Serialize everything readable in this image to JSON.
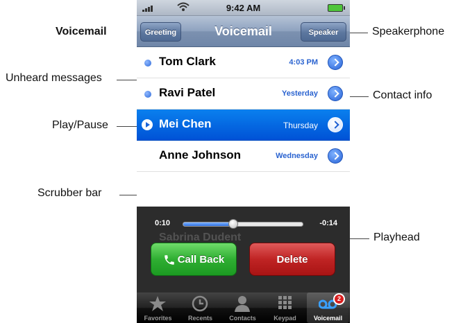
{
  "status_bar": {
    "time": "9:42 AM"
  },
  "nav_bar": {
    "title": "Voicemail",
    "left_button": "Greeting",
    "right_button": "Speaker"
  },
  "messages": [
    {
      "name": "Tom Clark",
      "time": "4:03 PM",
      "unheard": true,
      "selected": false
    },
    {
      "name": "Ravi Patel",
      "time": "Yesterday",
      "unheard": true,
      "selected": false
    },
    {
      "name": "Mei Chen",
      "time": "Thursday",
      "unheard": false,
      "selected": true
    },
    {
      "name": "Anne Johnson",
      "time": "Wednesday",
      "unheard": false,
      "selected": false
    }
  ],
  "playback": {
    "elapsed": "0:10",
    "remaining": "-0:14",
    "progress": 0.42,
    "call_back_label": "Call Back",
    "delete_label": "Delete",
    "behind_row_name": "Sabrina Dudent"
  },
  "tab_bar": {
    "tabs": [
      {
        "label": "Favorites",
        "icon": "star-icon",
        "active": false
      },
      {
        "label": "Recents",
        "icon": "clock-icon",
        "active": false
      },
      {
        "label": "Contacts",
        "icon": "person-icon",
        "active": false
      },
      {
        "label": "Keypad",
        "icon": "keypad-icon",
        "active": false
      },
      {
        "label": "Voicemail",
        "icon": "voicemail-icon",
        "active": true
      }
    ],
    "voicemail_badge": "2"
  },
  "callouts": {
    "voicemail": "Voicemail",
    "unheard": "Unheard messages",
    "play_pause": "Play/Pause",
    "scrubber": "Scrubber bar",
    "speakerphone": "Speakerphone",
    "contact_info": "Contact info",
    "playhead": "Playhead"
  },
  "colors": {
    "selection_blue": "#0a6ae6",
    "call_green": "#2fae32",
    "delete_red": "#c02424",
    "unheard_dot": "#2e6ad8"
  }
}
